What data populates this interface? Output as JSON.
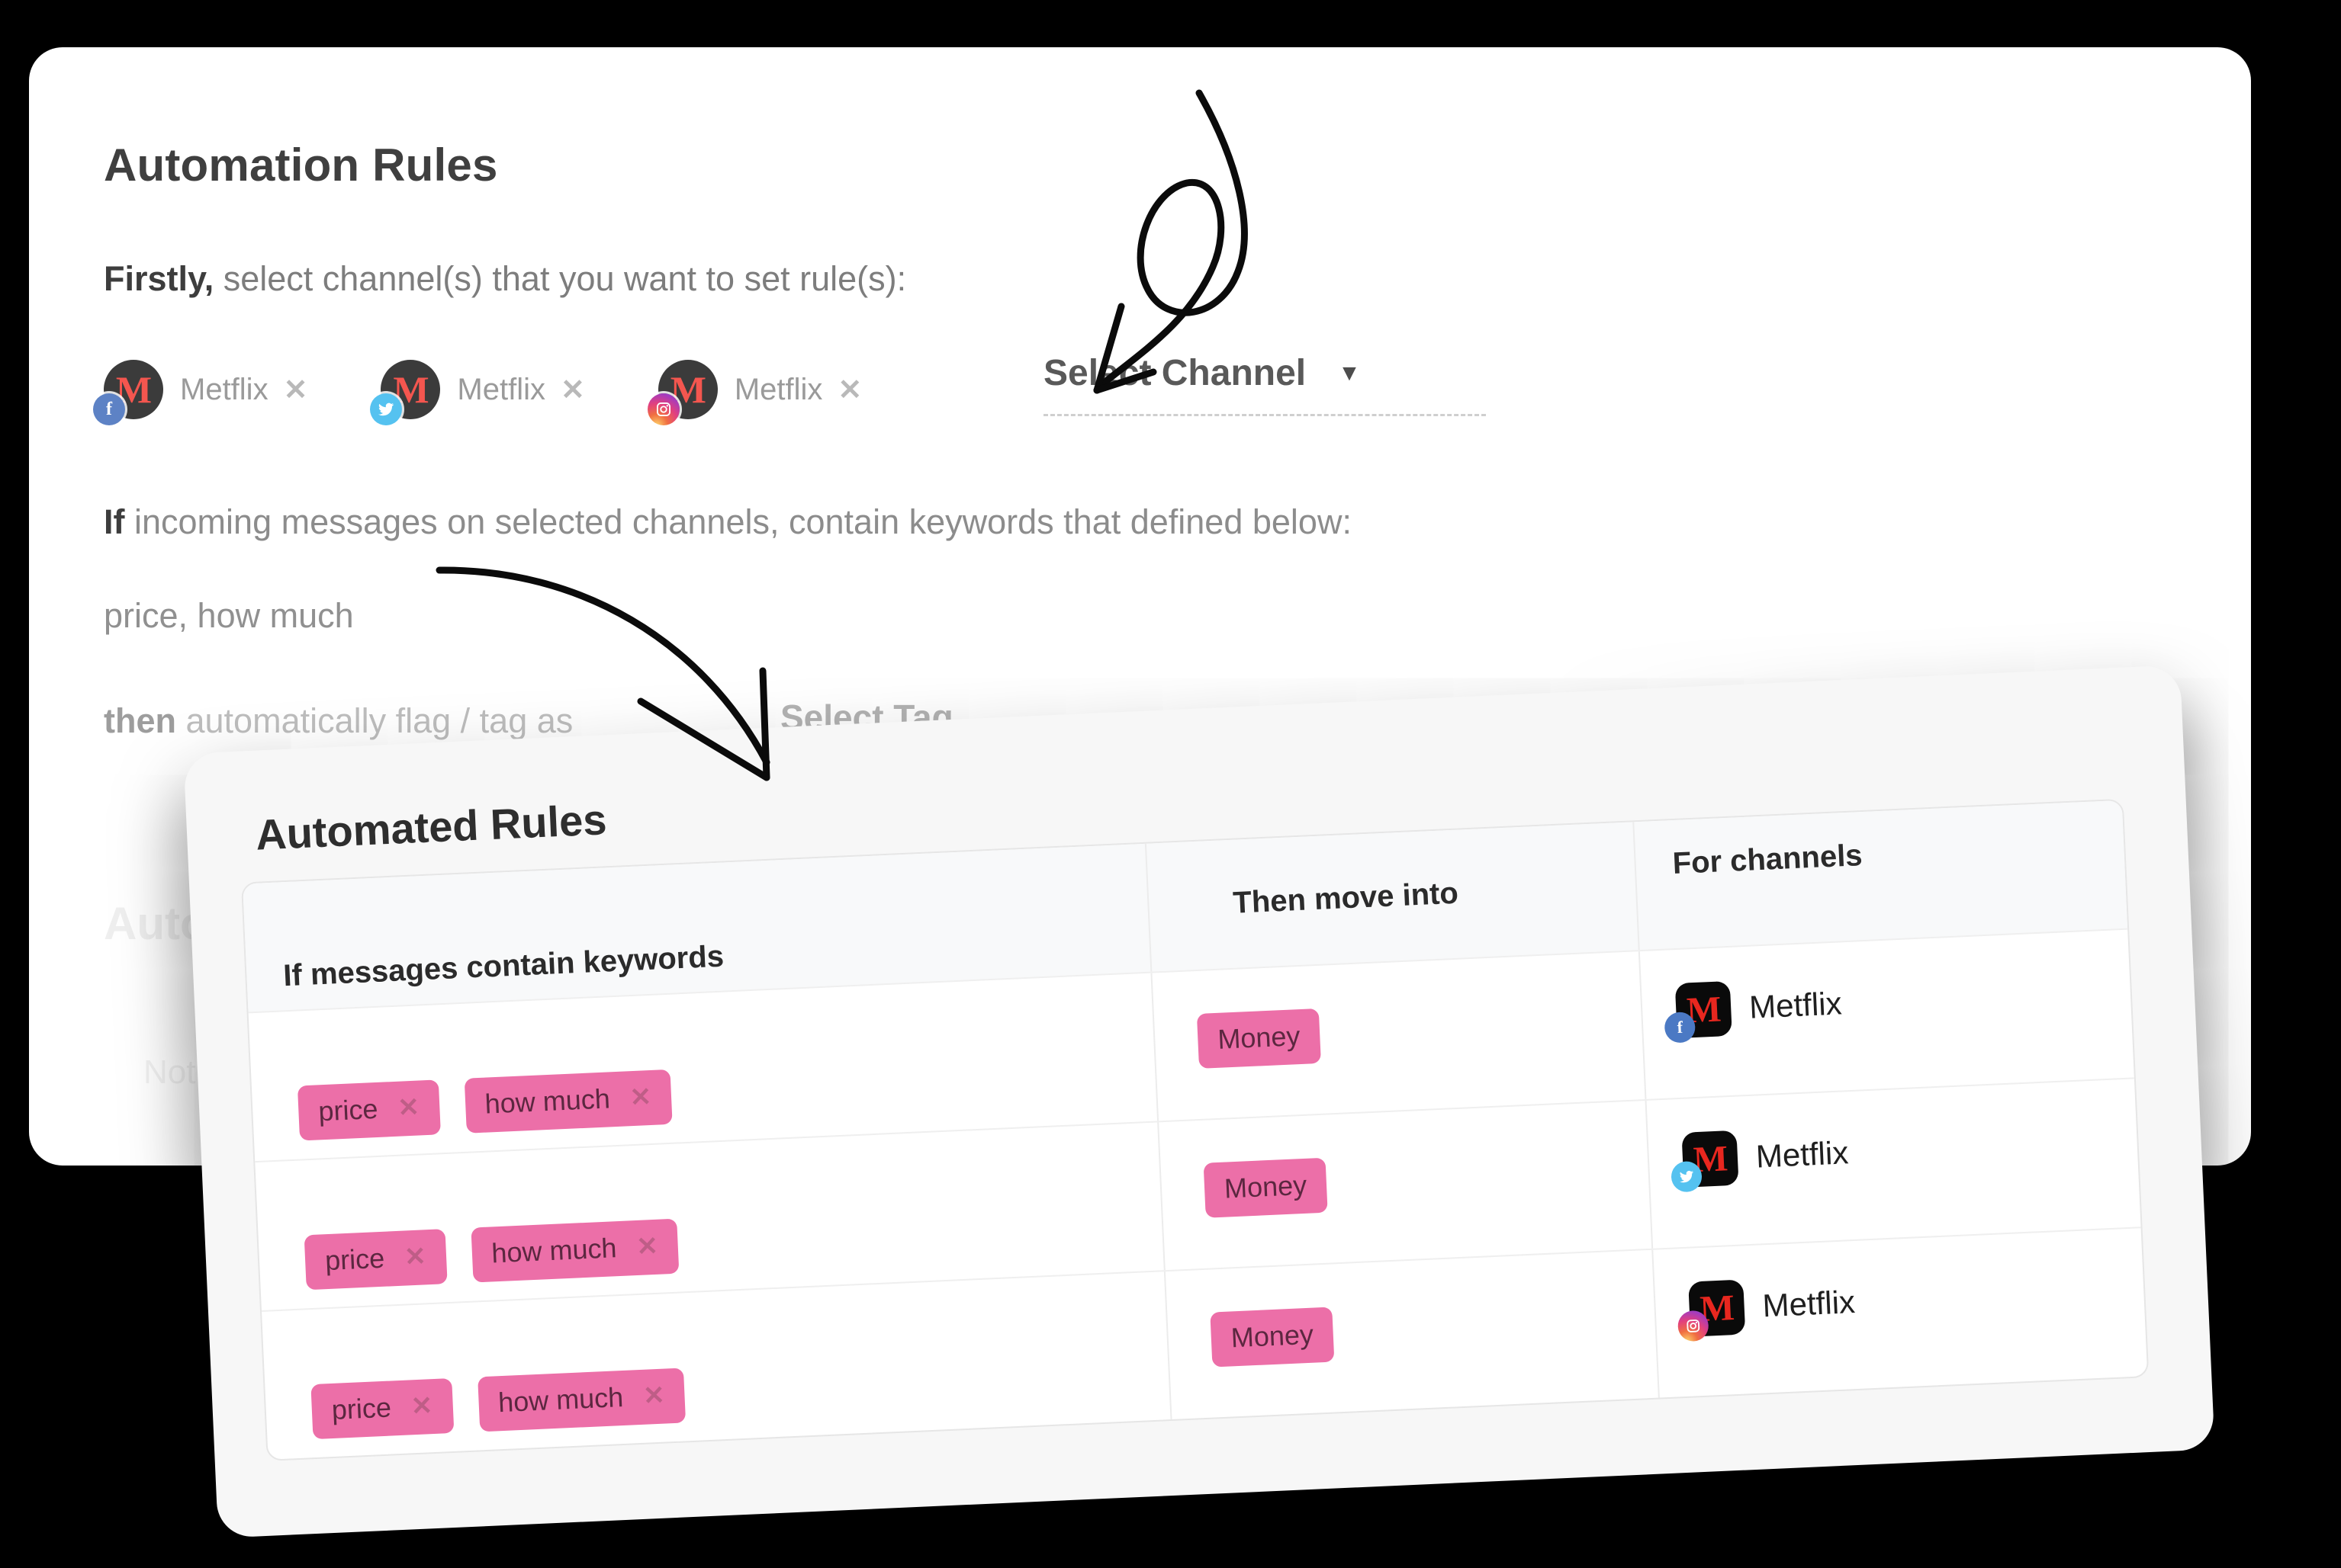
{
  "panel": {
    "cut_top_text": "",
    "title": "Automation Rules",
    "firstly_bold": "Firstly,",
    "firstly_rest": " select channel(s) that you want to set rule(s):",
    "channel_chips": [
      {
        "name": "Metflix",
        "initial": "M",
        "network": "facebook",
        "badge_glyph": "f",
        "remove_label": "✕"
      },
      {
        "name": "Metflix",
        "initial": "M",
        "network": "twitter",
        "badge_glyph": "🐦",
        "remove_label": "✕"
      },
      {
        "name": "Metflix",
        "initial": "M",
        "network": "instagram",
        "badge_glyph": "◎",
        "remove_label": "✕"
      }
    ],
    "select_channel_label": "Select Channel",
    "select_channel_caret": "▼",
    "if_bold": "If",
    "if_rest": " incoming messages on selected channels, contain keywords that defined below:",
    "keywords_value": "price, how much",
    "then_bold": "then",
    "then_rest": " automatically flag / tag as",
    "select_tag_label": "Select Tag",
    "ghost_title": "Automation Rules",
    "ghost_sub": "Not found"
  },
  "rules_card": {
    "title": "Automated Rules",
    "columns": [
      "If messages contain keywords",
      "Then move into",
      "For channels"
    ],
    "rows": [
      {
        "keywords": [
          {
            "label": "price",
            "remove": "✕"
          },
          {
            "label": "how much",
            "remove": "✕"
          }
        ],
        "tag": "Money",
        "channel": {
          "name": "Metflix",
          "initial": "M",
          "network": "facebook",
          "badge_glyph": "f"
        }
      },
      {
        "keywords": [
          {
            "label": "price",
            "remove": "✕"
          },
          {
            "label": "how much",
            "remove": "✕"
          }
        ],
        "tag": "Money",
        "channel": {
          "name": "Metflix",
          "initial": "M",
          "network": "twitter",
          "badge_glyph": "🐦"
        }
      },
      {
        "keywords": [
          {
            "label": "price",
            "remove": "✕"
          },
          {
            "label": "how much",
            "remove": "✕"
          }
        ],
        "tag": "Money",
        "channel": {
          "name": "Metflix",
          "initial": "M",
          "network": "instagram",
          "badge_glyph": "◎"
        }
      }
    ]
  },
  "annotations": {
    "arrow_to_select_channel": "curved-loop-arrow",
    "arrow_to_rules_card": "curved-arrow"
  },
  "colors": {
    "background": "#000000",
    "card": "#ffffff",
    "front_card": "#f7f7f7",
    "pill": "#ec6fa8",
    "pill_text": "#5c2740",
    "heading": "#3f3f3f",
    "muted_text": "#8c8c8c",
    "facebook": "#4b79c4",
    "twitter": "#55c2f0",
    "netflix_red": "#e8271f"
  }
}
